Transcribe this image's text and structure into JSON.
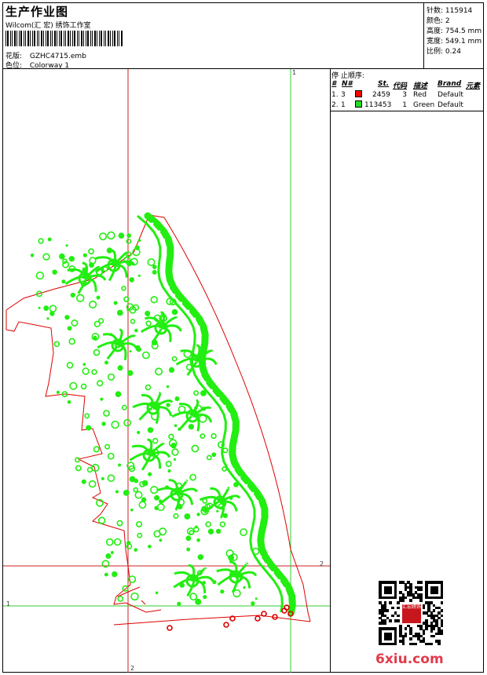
{
  "header": {
    "title": "生产作业图",
    "company": "Wilcom(汇 宏) 绣饰工作室",
    "design_label": "花版:",
    "design_value": "GZHC4715.emb",
    "colorway_label": "色位:",
    "colorway_value": "Colorway 1"
  },
  "stats": {
    "stitches_label": "针数:",
    "stitches_value": "115914",
    "colors_label": "颜色:",
    "colors_value": "2",
    "height_label": "高度:",
    "height_value": "754.5 mm",
    "width_label": "宽度:",
    "width_value": "549.1 mm",
    "ratio_label": "比例:",
    "ratio_value": "0.24"
  },
  "stop_sequence": {
    "title": "停 止顺序:",
    "headers": [
      "#",
      "N#",
      "St.",
      "代码",
      "描述",
      "Brand",
      "元素"
    ],
    "rows": [
      {
        "idx": "1.",
        "n": "3",
        "st": "2459",
        "code": "3",
        "desc": "Red",
        "brand": "Default",
        "color": "#ff0000"
      },
      {
        "idx": "2.",
        "n": "1",
        "st": "113453",
        "code": "1",
        "desc": "Green",
        "brand": "Default",
        "color": "#22dd22"
      }
    ]
  },
  "guides": {
    "label_1": "1",
    "label_2": "2"
  },
  "watermark": {
    "text": "6xiu.com",
    "seal_text": "汇宏绣饰"
  },
  "colors": {
    "design_green": "#22ee11",
    "outline_red": "#dd0000",
    "guide_green": "#33cc33",
    "guide_red": "#cc2222"
  }
}
